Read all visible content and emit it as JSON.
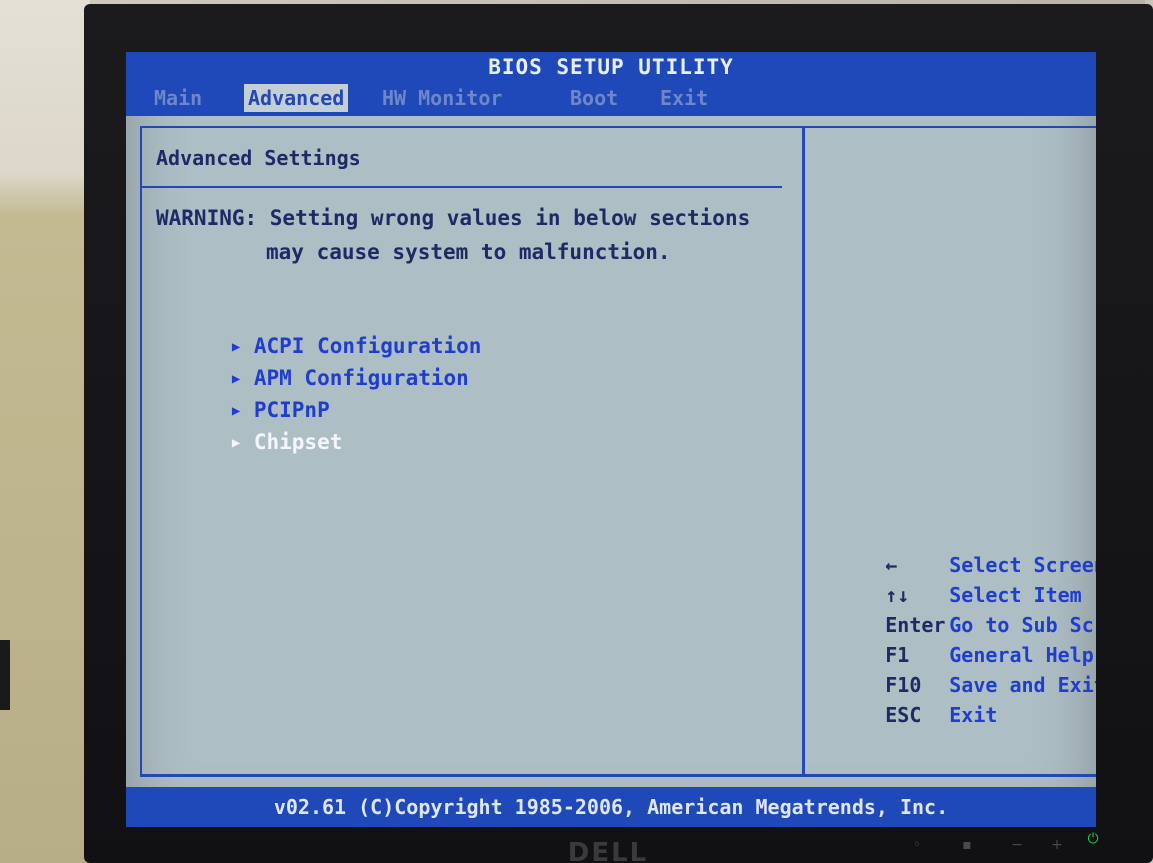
{
  "bios": {
    "title": "BIOS SETUP UTILITY",
    "tabs": [
      {
        "label": "Main"
      },
      {
        "label": "Advanced"
      },
      {
        "label": "HW Monitor"
      },
      {
        "label": "Boot"
      },
      {
        "label": "Exit"
      }
    ],
    "active_tab": "Advanced",
    "panel_title": "Advanced Settings",
    "warning_line_1": "WARNING: Setting wrong values in below sections",
    "warning_line_2": "may cause system to malfunction.",
    "menu_items": [
      {
        "label": "ACPI Configuration",
        "arrow": "▶",
        "selected": false
      },
      {
        "label": "APM Configuration",
        "arrow": "▶",
        "selected": false
      },
      {
        "label": "PCIPnP",
        "arrow": "▶",
        "selected": false
      },
      {
        "label": "Chipset",
        "arrow": "▶",
        "selected": true
      }
    ],
    "help": [
      {
        "key": "←",
        "desc": "Select Screen"
      },
      {
        "key": "↑↓",
        "desc": "Select Item"
      },
      {
        "key": "Enter",
        "desc": "Go to Sub Screen"
      },
      {
        "key": "F1",
        "desc": "General Help"
      },
      {
        "key": "F10",
        "desc": "Save and Exit"
      },
      {
        "key": "ESC",
        "desc": "Exit"
      }
    ],
    "footer": "v02.61 (C)Copyright 1985-2006, American Megatrends, Inc."
  },
  "monitor": {
    "brand": "DELL",
    "power_icon": "⏻"
  },
  "colors": {
    "bios_blue": "#1f49b9",
    "screen_bg": "#aebec5",
    "menu_text": "#1f3ed0",
    "selected_text": "#f4f6fb",
    "power_led": "#22c84a"
  }
}
